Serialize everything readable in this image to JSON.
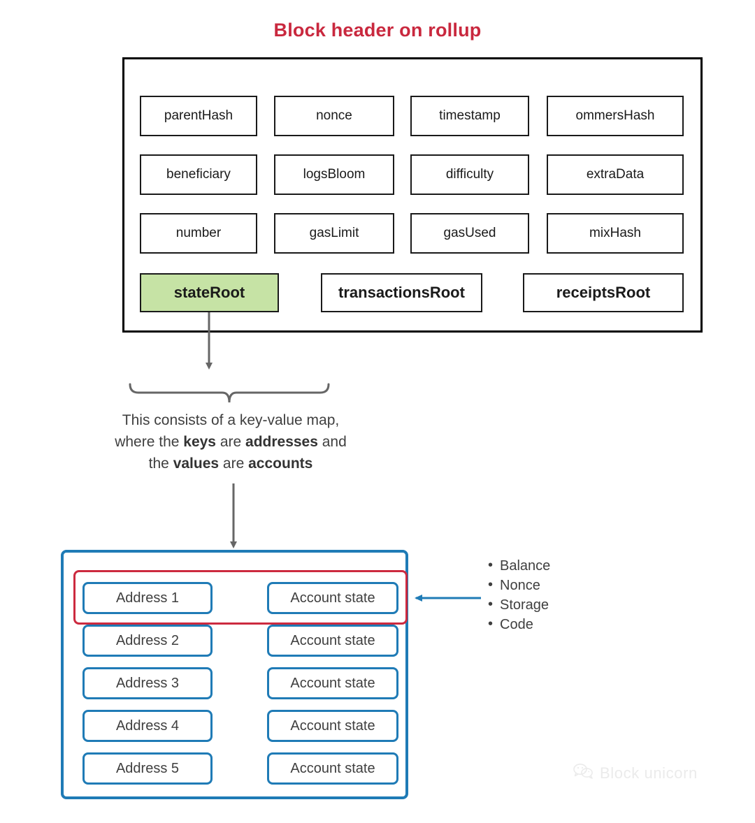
{
  "title": "Block header on rollup",
  "colors": {
    "title_red": "#c9283e",
    "highlight_green": "#c6e3a5",
    "box_blue": "#1f7bb6",
    "highlight_red": "#cc2a3f",
    "arrow_gray": "#666666",
    "text_dark": "#3f3f3f",
    "watermark_gray": "#ebebeb"
  },
  "block_header": {
    "fields": [
      {
        "label": "parentHash",
        "col": 1,
        "row": 1
      },
      {
        "label": "nonce",
        "col": 2,
        "row": 1
      },
      {
        "label": "timestamp",
        "col": 3,
        "row": 1
      },
      {
        "label": "ommersHash",
        "col": 4,
        "row": 1
      },
      {
        "label": "beneficiary",
        "col": 1,
        "row": 2
      },
      {
        "label": "logsBloom",
        "col": 2,
        "row": 2
      },
      {
        "label": "difficulty",
        "col": 3,
        "row": 2
      },
      {
        "label": "extraData",
        "col": 4,
        "row": 2
      },
      {
        "label": "number",
        "col": 1,
        "row": 3
      },
      {
        "label": "gasLimit",
        "col": 2,
        "row": 3
      },
      {
        "label": "gasUsed",
        "col": 3,
        "row": 3
      },
      {
        "label": "mixHash",
        "col": 4,
        "row": 3
      }
    ],
    "root_fields": [
      {
        "label": "stateRoot",
        "highlighted": true
      },
      {
        "label": "transactionsRoot",
        "highlighted": false
      },
      {
        "label": "receiptsRoot",
        "highlighted": false
      }
    ]
  },
  "explanation": {
    "line1": "This consists of a key-value map,",
    "line2_pre": "where the ",
    "line2_b1": "keys",
    "line2_mid": " are ",
    "line2_b2": "addresses",
    "line2_post": " and",
    "line3_pre": "the ",
    "line3_b1": "values",
    "line3_mid": " are ",
    "line3_b2": "accounts"
  },
  "state_map": {
    "rows": [
      {
        "key": "Address 1",
        "value": "Account state",
        "highlighted": true
      },
      {
        "key": "Address 2",
        "value": "Account state",
        "highlighted": false
      },
      {
        "key": "Address 3",
        "value": "Account state",
        "highlighted": false
      },
      {
        "key": "Address 4",
        "value": "Account state",
        "highlighted": false
      },
      {
        "key": "Address 5",
        "value": "Account state",
        "highlighted": false
      }
    ]
  },
  "account_state_fields": [
    {
      "label": "Balance"
    },
    {
      "label": "Nonce"
    },
    {
      "label": "Storage"
    },
    {
      "label": "Code"
    }
  ],
  "watermark": {
    "text": "Block unicorn",
    "icon": "wechat-icon"
  }
}
